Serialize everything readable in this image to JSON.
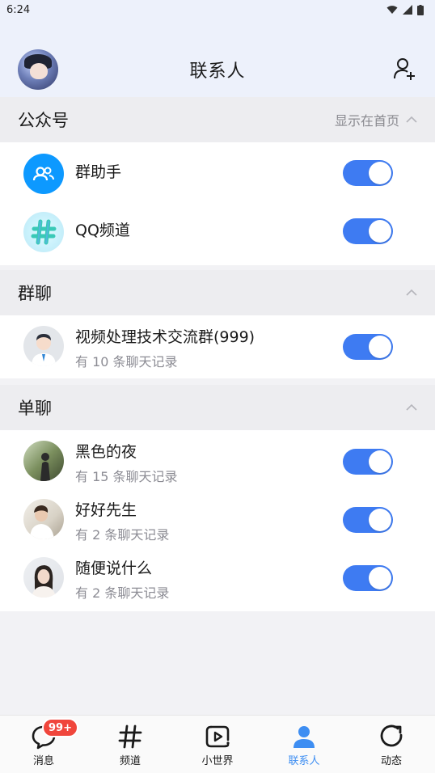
{
  "status_bar": {
    "time": "6:24"
  },
  "header": {
    "title": "联系人"
  },
  "sections": {
    "official": {
      "title": "公众号",
      "right_label": "显示在首页",
      "items": [
        {
          "name": "群助手",
          "enabled": true
        },
        {
          "name": "QQ频道",
          "enabled": true
        }
      ]
    },
    "groups": {
      "title": "群聊",
      "items": [
        {
          "name": "视频处理技术交流群(999)",
          "subtitle": "有 10 条聊天记录",
          "enabled": true
        }
      ]
    },
    "direct": {
      "title": "单聊",
      "items": [
        {
          "name": "黑色的夜",
          "subtitle": "有 15 条聊天记录",
          "enabled": true
        },
        {
          "name": "好好先生",
          "subtitle": "有 2 条聊天记录",
          "enabled": true
        },
        {
          "name": "随便说什么",
          "subtitle": "有 2 条聊天记录",
          "enabled": true
        }
      ]
    }
  },
  "tabbar": {
    "items": [
      {
        "label": "消息",
        "icon": "message-icon",
        "badge": "99+"
      },
      {
        "label": "频道",
        "icon": "hashtag-icon"
      },
      {
        "label": "小世界",
        "icon": "play-icon"
      },
      {
        "label": "联系人",
        "icon": "contacts-icon",
        "active": true
      },
      {
        "label": "动态",
        "icon": "refresh-icon"
      }
    ]
  },
  "colors": {
    "accent": "#3e7bf2",
    "active_tab": "#3e8ef2",
    "header_bg": "#edf1fb",
    "badge": "#f0463c"
  }
}
